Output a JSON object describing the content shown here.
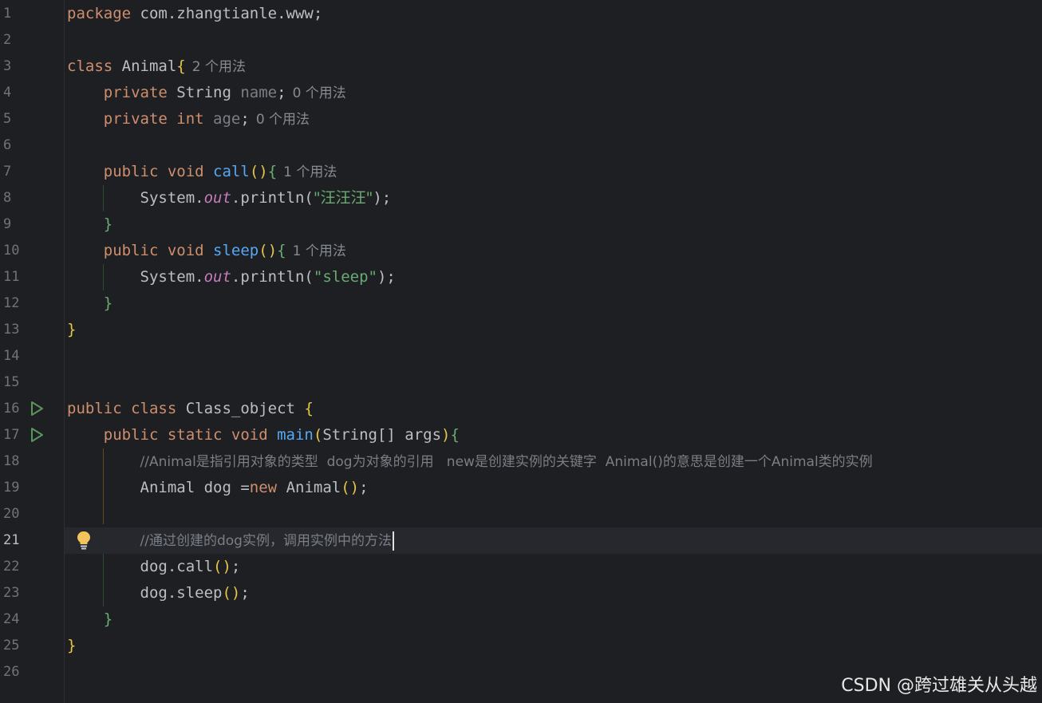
{
  "line_numbers": [
    "1",
    "2",
    "3",
    "4",
    "5",
    "6",
    "7",
    "8",
    "9",
    "10",
    "11",
    "12",
    "13",
    "14",
    "15",
    "16",
    "17",
    "18",
    "19",
    "20",
    "21",
    "22",
    "23",
    "24",
    "25",
    "26"
  ],
  "code": {
    "l1": {
      "kw": "package",
      "rest": " com.zhangtianle.www;"
    },
    "l3": {
      "kw": "class",
      "name": " Animal",
      "brace": "{",
      "hint": "2 个用法"
    },
    "l4": {
      "kw": "private",
      "type": " String ",
      "field": "name",
      "semi": ";",
      "hint": "0 个用法"
    },
    "l5": {
      "kw": "private int",
      "field": " age",
      "semi": ";",
      "hint": "0 个用法"
    },
    "l7": {
      "kw": "public void",
      "fn": " call",
      "paren": "()",
      "brace": "{",
      "hint": "1 个用法"
    },
    "l8": {
      "prefix": "System.",
      "out": "out",
      "mid": ".println(",
      "str": "\"汪汪汪\"",
      "end": ");"
    },
    "l9": {
      "brace": "}"
    },
    "l10": {
      "kw": "public void",
      "fn": " sleep",
      "paren": "()",
      "brace": "{",
      "hint": "1 个用法"
    },
    "l11": {
      "prefix": "System.",
      "out": "out",
      "mid": ".println(",
      "str": "\"sleep\"",
      "end": ");"
    },
    "l12": {
      "brace": "}"
    },
    "l13": {
      "brace": "}"
    },
    "l16": {
      "kw": "public class",
      "name": " Class_object ",
      "brace": "{"
    },
    "l17": {
      "kw": "public static void",
      "fn": " main",
      "paren_open": "(",
      "args": "String[] args",
      "paren_close": ")",
      "brace": "{"
    },
    "l18": {
      "comment": "//Animal是指引用对象的类型  dog为对象的引用   new是创建实例的关键字  Animal()的意思是创建一个Animal类的实例"
    },
    "l19": {
      "pre": "Animal dog =",
      "kw": "new",
      "post": " Animal",
      "paren": "()",
      "semi": ";"
    },
    "l21": {
      "comment": "//通过创建的dog实例，调用实例中的方法"
    },
    "l22": {
      "text": "dog.call",
      "paren": "()",
      "semi": ";"
    },
    "l23": {
      "text": "dog.sleep",
      "paren": "()",
      "semi": ";"
    },
    "l24": {
      "brace": "}"
    },
    "l25": {
      "brace": "}"
    }
  },
  "watermark": "CSDN @跨过雄关从头越",
  "icons": {
    "run": "run-gutter-icon",
    "bulb": "lightbulb-intention-icon"
  },
  "colors": {
    "keyword": "#cf8e6d",
    "function": "#56a8f5",
    "string": "#6aab73",
    "comment": "#7a7e85",
    "background": "#1e1f22"
  }
}
